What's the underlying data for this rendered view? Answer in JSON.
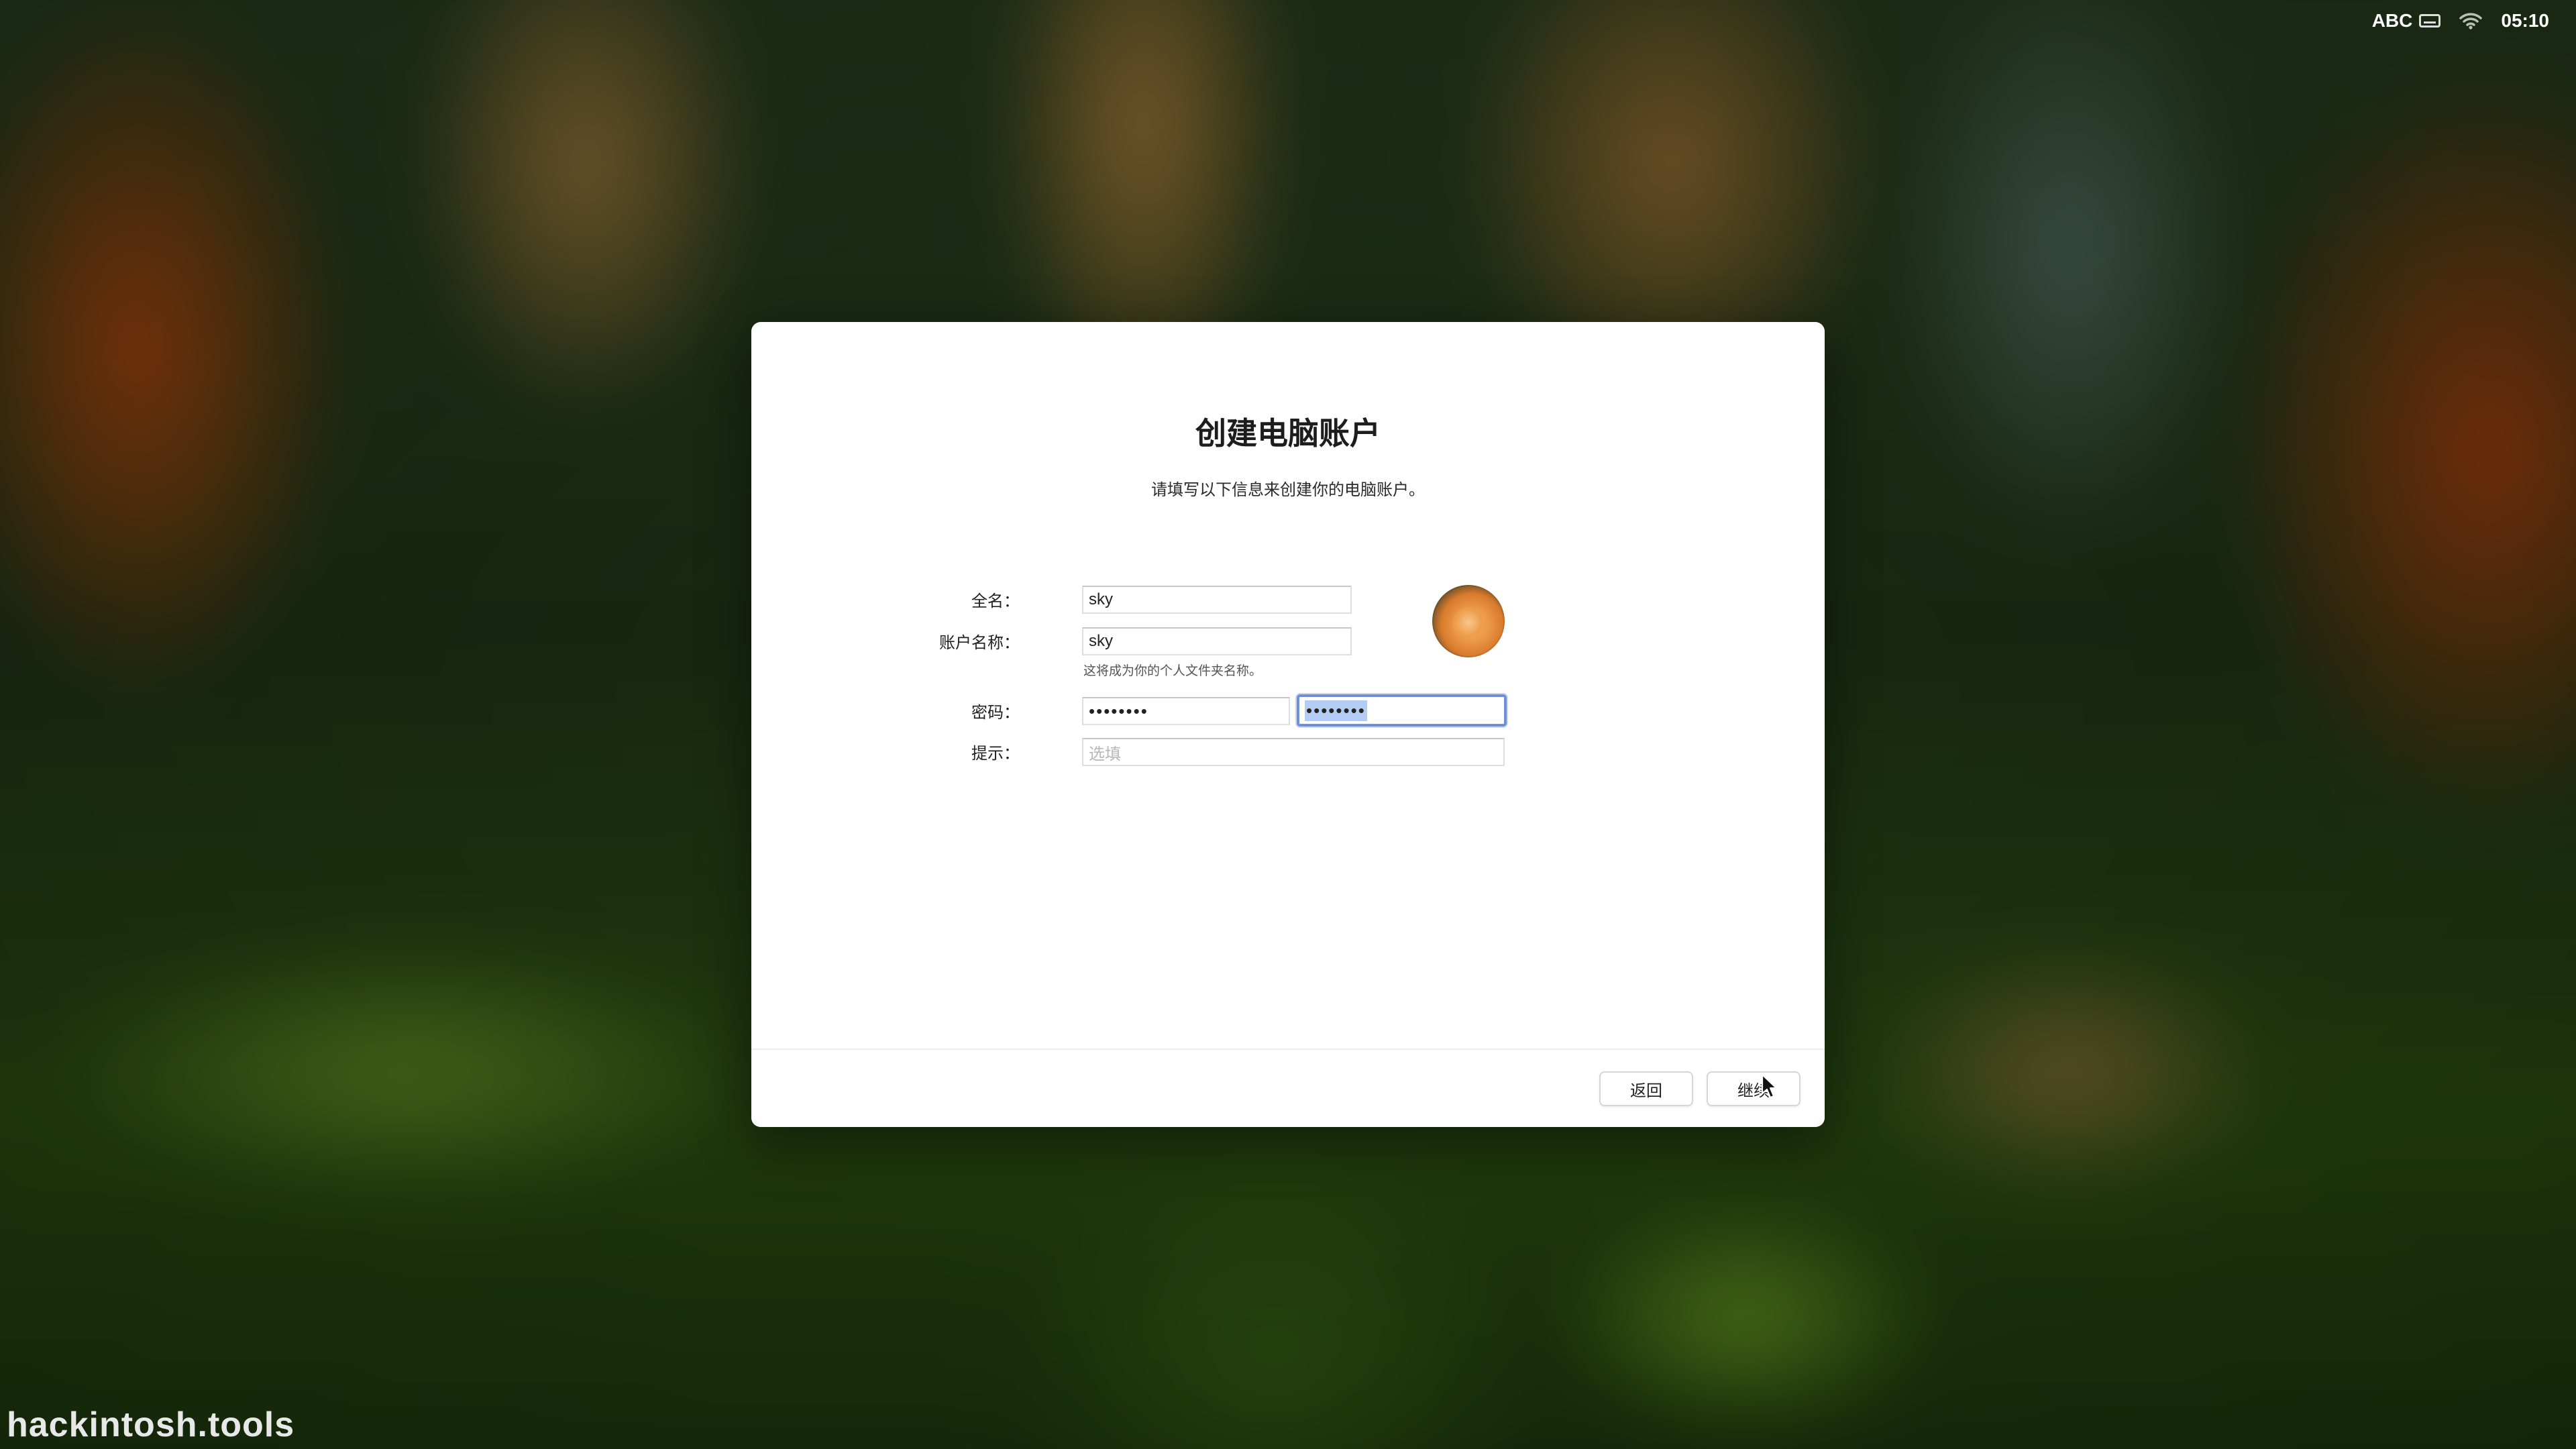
{
  "status_bar": {
    "input_source": "ABC",
    "input_icon": "keyboard-icon",
    "wifi_icon": "wifi-icon",
    "clock": "05:10"
  },
  "watermark": "hackintosh.tools",
  "dialog": {
    "title": "创建电脑账户",
    "subtitle": "请填写以下信息来创建你的电脑账户。",
    "fields": {
      "full_name": {
        "label": "全名：",
        "value": "sky"
      },
      "account_name": {
        "label": "账户名称：",
        "value": "sky",
        "note": "这将成为你的个人文件夹名称。"
      },
      "password": {
        "label": "密码：",
        "value": "••••••••"
      },
      "verify_password": {
        "value": "••••••••"
      },
      "hint": {
        "label": "提示：",
        "placeholder": "选填"
      }
    },
    "avatar_icon": "user-avatar-rose-image",
    "buttons": {
      "back": "返回",
      "continue": "继续"
    }
  },
  "colors": {
    "focus_ring": "#6f8fd6",
    "selection": "#b3ccf3"
  }
}
